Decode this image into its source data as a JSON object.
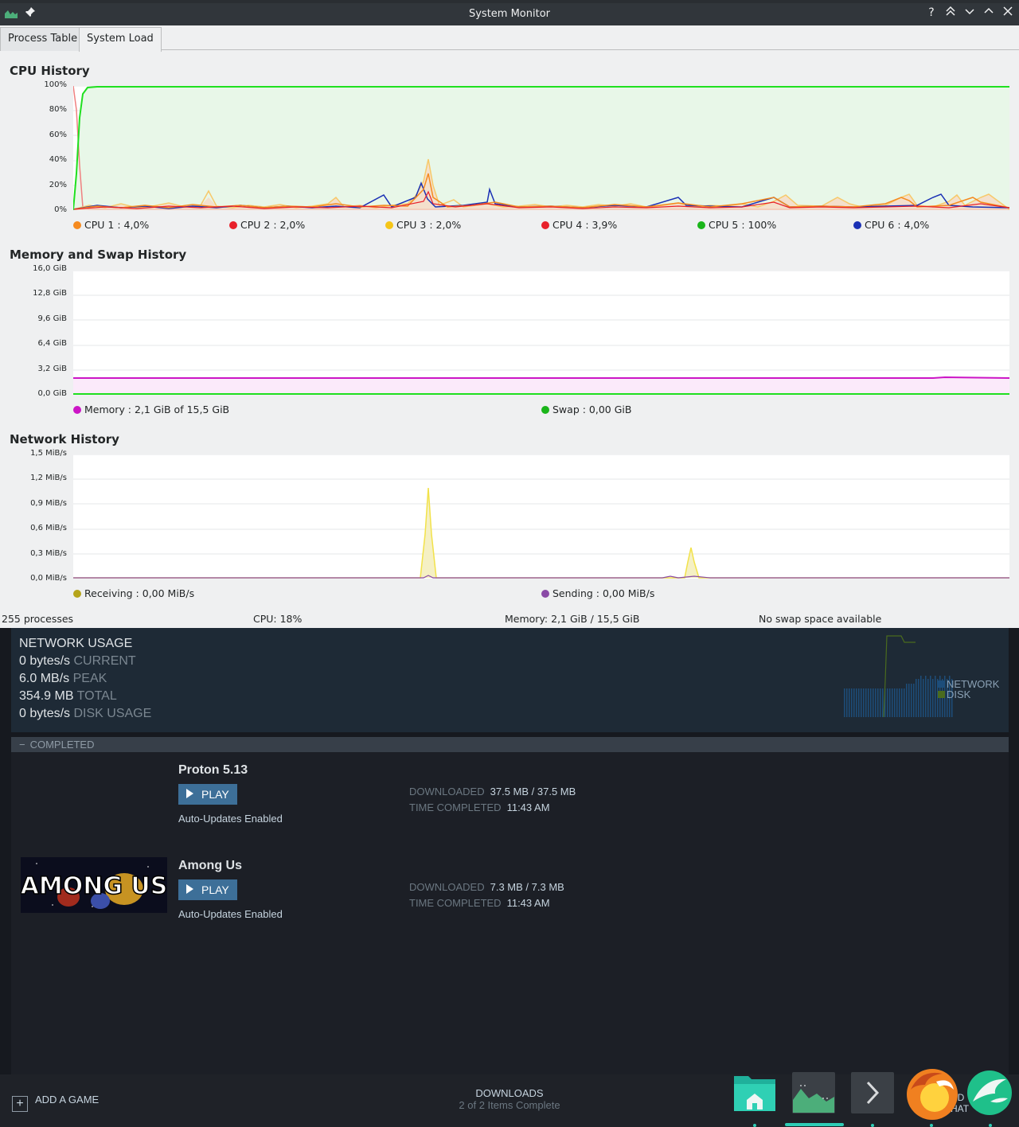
{
  "window": {
    "title": "System Monitor",
    "controls": [
      "?",
      "keep-above",
      "minimize",
      "maximize",
      "close"
    ]
  },
  "tabs": [
    {
      "label": "Process Table",
      "active": false
    },
    {
      "label": "System Load",
      "active": true
    }
  ],
  "cpu": {
    "title": "CPU History",
    "yticks": [
      "100%",
      "80%",
      "60%",
      "40%",
      "20%",
      "0%"
    ],
    "legend": [
      {
        "label": "CPU 1 : 4,0%",
        "color": "#f58a1f"
      },
      {
        "label": "CPU 2 : 2,0%",
        "color": "#e8202a"
      },
      {
        "label": "CPU 3 : 2,0%",
        "color": "#f5c518"
      },
      {
        "label": "CPU 4 : 3,9%",
        "color": "#e8202a"
      },
      {
        "label": "CPU 5 : 100%",
        "color": "#1ab51a"
      },
      {
        "label": "CPU 6 : 4,0%",
        "color": "#1a30b5"
      }
    ]
  },
  "memory": {
    "title": "Memory and Swap History",
    "yticks": [
      "16,0 GiB",
      "12,8 GiB",
      "9,6 GiB",
      "6,4 GiB",
      "3,2 GiB",
      "0,0 GiB"
    ],
    "legend": [
      {
        "label": "Memory : 2,1 GiB of 15,5 GiB",
        "color": "#cc15c6"
      },
      {
        "label": "Swap : 0,00 GiB",
        "color": "#1ab51a"
      }
    ]
  },
  "network": {
    "title": "Network History",
    "yticks": [
      "1,5 MiB/s",
      "1,2 MiB/s",
      "0,9 MiB/s",
      "0,6 MiB/s",
      "0,3 MiB/s",
      "0,0 MiB/s"
    ],
    "legend": [
      {
        "label": "Receiving : 0,00 MiB/s",
        "color": "#b5a41a"
      },
      {
        "label": "Sending : 0,00 MiB/s",
        "color": "#8a4aa6"
      }
    ]
  },
  "statusbar": {
    "processes": "255 processes",
    "cpu": "CPU: 18%",
    "memory": "Memory: 2,1 GiB / 15,5 GiB",
    "swap": "No swap space available"
  },
  "steam": {
    "network_usage": {
      "title": "NETWORK USAGE",
      "rows": [
        {
          "value": "0 bytes/s",
          "label": "CURRENT"
        },
        {
          "value": "6.0 MB/s",
          "label": "PEAK"
        },
        {
          "value": "354.9 MB",
          "label": "TOTAL"
        },
        {
          "value": "0 bytes/s",
          "label": "DISK USAGE"
        }
      ],
      "legend": [
        {
          "label": "NETWORK",
          "color": "#1d4d7a"
        },
        {
          "label": "DISK",
          "color": "#4a6b1e"
        }
      ]
    },
    "completed_label": "COMPLETED",
    "collapse_symbol": "−",
    "items": [
      {
        "name": "Proton 5.13",
        "play": "PLAY",
        "auto": "Auto-Updates Enabled",
        "downloaded_key": "DOWNLOADED",
        "downloaded_val": "37.5 MB / 37.5 MB",
        "time_key": "TIME COMPLETED",
        "time_val": "11:43 AM"
      },
      {
        "name": "Among Us",
        "play": "PLAY",
        "auto": "Auto-Updates Enabled",
        "downloaded_key": "DOWNLOADED",
        "downloaded_val": "7.3 MB / 7.3 MB",
        "time_key": "TIME COMPLETED",
        "time_val": "11:43 AM",
        "thumb_text": "AMONG US"
      }
    ],
    "add_game": "ADD A GAME",
    "add_symbol": "+",
    "downloads": "DOWNLOADS",
    "downloads_sub": "2 of 2 Items Complete",
    "friends_partial": [
      "ND",
      "HAT"
    ]
  },
  "dock": {
    "icons": [
      "folder-icon",
      "system-monitor-icon",
      "terminal-icon",
      "firefox-icon",
      "krita-icon"
    ]
  }
}
